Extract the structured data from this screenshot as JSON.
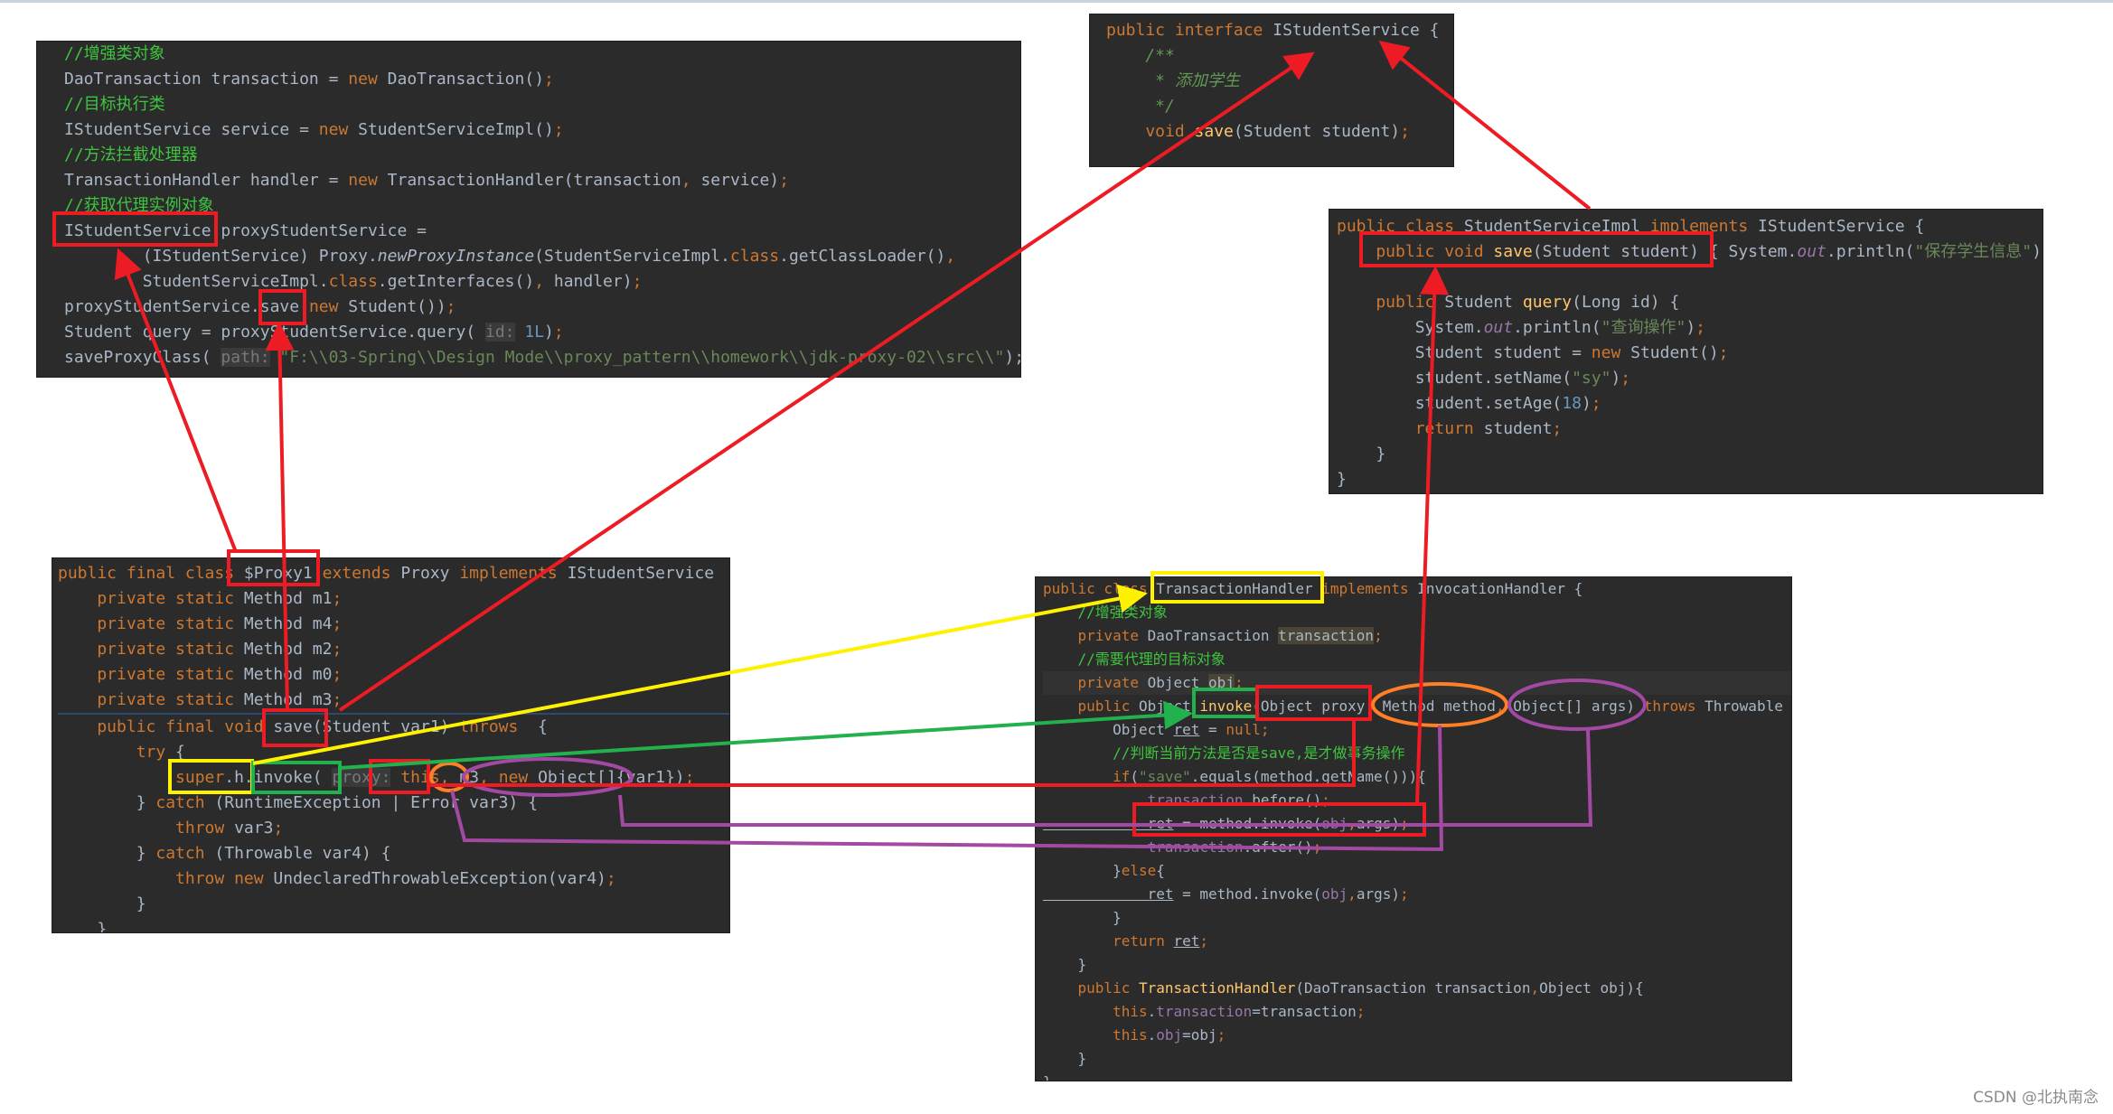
{
  "panels": {
    "client": [
      [
        [
          "//增强类对象",
          "c"
        ]
      ],
      [
        [
          "DaoTransaction transaction = ",
          "t"
        ],
        [
          "new ",
          "k"
        ],
        [
          "DaoTransaction()",
          "t"
        ],
        [
          ";",
          "k"
        ]
      ],
      [
        [
          "//目标执行类",
          "c"
        ]
      ],
      [
        [
          "IStudentService service = ",
          "t"
        ],
        [
          "new ",
          "k"
        ],
        [
          "StudentServiceImpl()",
          "t"
        ],
        [
          ";",
          "k"
        ]
      ],
      [
        [
          "//方法拦截处理器",
          "c"
        ]
      ],
      [
        [
          "TransactionHandler handler = ",
          "t"
        ],
        [
          "new ",
          "k"
        ],
        [
          "TransactionHandler(transaction",
          "t"
        ],
        [
          ", ",
          "k"
        ],
        [
          "service)",
          "t"
        ],
        [
          ";",
          "k"
        ]
      ],
      [
        [
          "//获取代理实例对象",
          "c"
        ]
      ],
      [
        [
          "IStudentService proxyStudentService =",
          "t"
        ]
      ],
      [
        [
          "        (IStudentService) Proxy.",
          "t"
        ],
        [
          "newProxyInstance",
          "tx"
        ],
        [
          "(StudentServiceImpl.",
          "t"
        ],
        [
          "class",
          "k"
        ],
        [
          ".getClassLoader()",
          "t"
        ],
        [
          ",",
          "k"
        ]
      ],
      [
        [
          "        StudentServiceImpl.",
          "t"
        ],
        [
          "class",
          "k"
        ],
        [
          ".getInterfaces()",
          "t"
        ],
        [
          ", ",
          "k"
        ],
        [
          "handler)",
          "t"
        ],
        [
          ";",
          "k"
        ]
      ],
      [
        [
          "proxyStudentService.save(",
          "t"
        ],
        [
          "new ",
          "k"
        ],
        [
          "Student())",
          "t"
        ],
        [
          ";",
          "k"
        ]
      ],
      [
        [
          "Student query = proxyStudentService.query( ",
          "t"
        ],
        [
          "id:",
          "h"
        ],
        [
          " 1L",
          "n"
        ],
        [
          ")",
          "t"
        ],
        [
          ";",
          "k"
        ]
      ],
      [
        [
          "saveProxyClass( ",
          "t"
        ],
        [
          "path:",
          "h"
        ],
        [
          " \"F:\\\\03-Spring\\\\Design Mode\\\\proxy_pattern\\\\homework\\\\jdk-proxy-02\\\\src\\\\\"",
          "s"
        ],
        [
          ");",
          "t"
        ]
      ]
    ],
    "interface": [
      [
        [
          "public interface ",
          "k"
        ],
        [
          "IStudentService {",
          "t"
        ]
      ],
      [
        [
          "    /**",
          "d"
        ]
      ],
      [
        [
          "     * 添加学生",
          "d"
        ]
      ],
      [
        [
          "     */",
          "d"
        ]
      ],
      [
        [
          "    void ",
          "k"
        ],
        [
          "save",
          "m"
        ],
        [
          "(Student student)",
          "t"
        ],
        [
          ";",
          "k"
        ]
      ]
    ],
    "impl": [
      [
        [
          "public class ",
          "k"
        ],
        [
          "StudentServiceImpl ",
          "t"
        ],
        [
          "implements ",
          "k"
        ],
        [
          "IStudentService {",
          "t"
        ]
      ],
      [
        [
          "    public void ",
          "k"
        ],
        [
          "save",
          "m"
        ],
        [
          "(Student student) { System.",
          "t"
        ],
        [
          "out",
          "fi"
        ],
        [
          ".println(",
          "t"
        ],
        [
          "\"保存学生信息\"",
          "s"
        ],
        [
          ");",
          "t"
        ]
      ],
      [
        [
          "",
          "t"
        ]
      ],
      [
        [
          "    public ",
          "k"
        ],
        [
          "Student ",
          "t"
        ],
        [
          "query",
          "m"
        ],
        [
          "(Long id) {",
          "t"
        ]
      ],
      [
        [
          "        System.",
          "t"
        ],
        [
          "out",
          "fi"
        ],
        [
          ".println(",
          "t"
        ],
        [
          "\"查询操作\"",
          "s"
        ],
        [
          ")",
          "t"
        ],
        [
          ";",
          "k"
        ]
      ],
      [
        [
          "        Student student = ",
          "t"
        ],
        [
          "new ",
          "k"
        ],
        [
          "Student()",
          "t"
        ],
        [
          ";",
          "k"
        ]
      ],
      [
        [
          "        student.setName(",
          "t"
        ],
        [
          "\"sy\"",
          "s"
        ],
        [
          ")",
          "t"
        ],
        [
          ";",
          "k"
        ]
      ],
      [
        [
          "        student.setAge(",
          "t"
        ],
        [
          "18",
          "n"
        ],
        [
          ")",
          "t"
        ],
        [
          ";",
          "k"
        ]
      ],
      [
        [
          "        return ",
          "k"
        ],
        [
          "student",
          "t"
        ],
        [
          ";",
          "k"
        ]
      ],
      [
        [
          "    }",
          "t"
        ]
      ],
      [
        [
          "}",
          "t"
        ]
      ]
    ],
    "proxy": [
      [
        [
          "public final class ",
          "k"
        ],
        [
          "$Proxy1 ",
          "t"
        ],
        [
          "extends ",
          "k"
        ],
        [
          "Proxy ",
          "t"
        ],
        [
          "implements ",
          "k"
        ],
        [
          "IStudentService",
          "t"
        ]
      ],
      [
        [
          "    private static ",
          "k"
        ],
        [
          "Method m1",
          "t"
        ],
        [
          ";",
          "k"
        ]
      ],
      [
        [
          "    private static ",
          "k"
        ],
        [
          "Method m4",
          "t"
        ],
        [
          ";",
          "k"
        ]
      ],
      [
        [
          "    private static ",
          "k"
        ],
        [
          "Method m2",
          "t"
        ],
        [
          ";",
          "k"
        ]
      ],
      [
        [
          "    private static ",
          "k"
        ],
        [
          "Method m0",
          "t"
        ],
        [
          ";",
          "k"
        ]
      ],
      [
        [
          "    private static ",
          "k"
        ],
        [
          "Method m3",
          "t"
        ],
        [
          ";",
          "k"
        ]
      ],
      [
        [
          "    public final void ",
          "k"
        ],
        [
          "save(Student var1) ",
          "t"
        ],
        [
          "throws ",
          "k"
        ],
        [
          " {",
          "t"
        ]
      ],
      [
        [
          "        try ",
          "k"
        ],
        [
          "{",
          "t"
        ]
      ],
      [
        [
          "            super",
          "k"
        ],
        [
          ".h.invoke( ",
          "t"
        ],
        [
          "proxy:",
          "h"
        ],
        [
          " this",
          "k"
        ],
        [
          ", ",
          "k"
        ],
        [
          "m3",
          "t"
        ],
        [
          ", ",
          "k"
        ],
        [
          "new ",
          "k"
        ],
        [
          "Object[]{var1})",
          "t"
        ],
        [
          ";",
          "k"
        ]
      ],
      [
        [
          "        } ",
          "t"
        ],
        [
          "catch ",
          "k"
        ],
        [
          "(RuntimeException | Error var3) {",
          "t"
        ]
      ],
      [
        [
          "            throw ",
          "k"
        ],
        [
          "var3",
          "t"
        ],
        [
          ";",
          "k"
        ]
      ],
      [
        [
          "        } ",
          "t"
        ],
        [
          "catch ",
          "k"
        ],
        [
          "(Throwable var4) {",
          "t"
        ]
      ],
      [
        [
          "            throw new ",
          "k"
        ],
        [
          "UndeclaredThrowableException(var4)",
          "t"
        ],
        [
          ";",
          "k"
        ]
      ],
      [
        [
          "        }",
          "t"
        ]
      ],
      [
        [
          "    }",
          "t"
        ]
      ]
    ],
    "handler": [
      [
        [
          "public class ",
          "k"
        ],
        [
          "TransactionHandler ",
          "t"
        ],
        [
          "implements ",
          "k"
        ],
        [
          "InvocationHandler {",
          "t"
        ]
      ],
      [
        [
          "    //增强类对象",
          "c"
        ]
      ],
      [
        [
          "    private ",
          "k"
        ],
        [
          "DaoTransaction ",
          "t"
        ],
        [
          "transaction",
          "hb"
        ],
        [
          ";",
          "k"
        ]
      ],
      [
        [
          "    //需要代理的目标对象",
          "c"
        ]
      ],
      [
        [
          "    private ",
          "k"
        ],
        [
          "Object ",
          "t"
        ],
        [
          "obj",
          "hb"
        ],
        [
          ";",
          "k"
        ]
      ],
      [
        [
          "    public ",
          "k"
        ],
        [
          "Object ",
          "t"
        ],
        [
          "invoke",
          "m"
        ],
        [
          "(Object proxy",
          "t"
        ],
        [
          ", ",
          "k"
        ],
        [
          "Method method",
          "t"
        ],
        [
          ", ",
          "k"
        ],
        [
          "Object[] args) ",
          "t"
        ],
        [
          "throws ",
          "k"
        ],
        [
          "Throwable",
          "t"
        ]
      ],
      [
        [
          "        Object ",
          "t"
        ],
        [
          "ret",
          "u"
        ],
        [
          " = ",
          "t"
        ],
        [
          "null",
          "k"
        ],
        [
          ";",
          "k"
        ]
      ],
      [
        [
          "        //判断当前方法是否是save,是才做事务操作",
          "c"
        ]
      ],
      [
        [
          "        if",
          "k"
        ],
        [
          "(",
          "t"
        ],
        [
          "\"save\"",
          "s"
        ],
        [
          ".equals(method.getName())){",
          "t"
        ]
      ],
      [
        [
          "            transaction",
          "f"
        ],
        [
          ".before()",
          "t"
        ],
        [
          ";",
          "k"
        ]
      ],
      [
        [
          "            ret",
          "u"
        ],
        [
          " = method.invoke(",
          "t"
        ],
        [
          "obj",
          "f"
        ],
        [
          ",",
          "k"
        ],
        [
          "args)",
          "t"
        ],
        [
          ";",
          "k"
        ]
      ],
      [
        [
          "            transaction",
          "f"
        ],
        [
          ".after()",
          "t"
        ],
        [
          ";",
          "k"
        ]
      ],
      [
        [
          "        }",
          "t"
        ],
        [
          "else",
          "k"
        ],
        [
          "{",
          "t"
        ]
      ],
      [
        [
          "            ret",
          "u"
        ],
        [
          " = method.invoke(",
          "t"
        ],
        [
          "obj",
          "f"
        ],
        [
          ",",
          "k"
        ],
        [
          "args)",
          "t"
        ],
        [
          ";",
          "k"
        ]
      ],
      [
        [
          "        }",
          "t"
        ]
      ],
      [
        [
          "        return ",
          "k"
        ],
        [
          "ret",
          "u"
        ],
        [
          ";",
          "k"
        ]
      ],
      [
        [
          "    }",
          "t"
        ]
      ],
      [
        [
          "    public ",
          "k"
        ],
        [
          "TransactionHandler",
          "m"
        ],
        [
          "(DaoTransaction transaction",
          "t"
        ],
        [
          ",",
          "k"
        ],
        [
          "Object obj){",
          "t"
        ]
      ],
      [
        [
          "        this",
          "k"
        ],
        [
          ".",
          "t"
        ],
        [
          "transaction",
          "f"
        ],
        [
          "=transaction",
          "t"
        ],
        [
          ";",
          "k"
        ]
      ],
      [
        [
          "        this",
          "k"
        ],
        [
          ".",
          "t"
        ],
        [
          "obj",
          "f"
        ],
        [
          "=obj",
          "t"
        ],
        [
          ";",
          "k"
        ]
      ],
      [
        [
          "    }",
          "t"
        ]
      ],
      [
        [
          "}",
          "t"
        ]
      ]
    ]
  },
  "annotation_colors": {
    "red": "#ed1c24",
    "yellow": "#fff200",
    "green": "#22b14c",
    "orange": "#ff7f27",
    "purple": "#a349a4"
  },
  "watermark": "CSDN @北执南念"
}
